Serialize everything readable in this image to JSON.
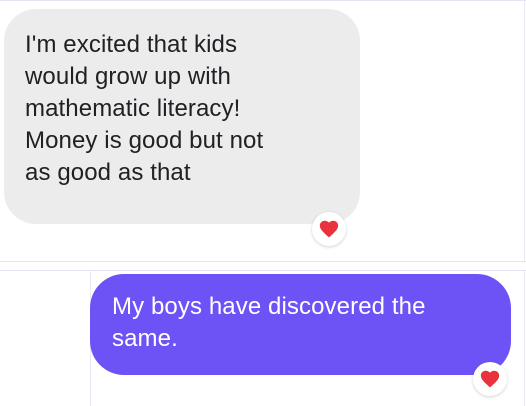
{
  "conversation": {
    "messages": [
      {
        "direction": "received",
        "text": "I'm excited that kids\nwould grow up with\nmathematic literacy!\nMoney is good but not\nas good as that",
        "reaction": "heart-icon"
      },
      {
        "direction": "sent",
        "text": "My boys have discovered the\nsame.",
        "reaction": "heart-icon"
      }
    ]
  },
  "colors": {
    "received_bubble": "#ececed",
    "sent_bubble": "#6d53f6",
    "heart": "#e9323c"
  }
}
